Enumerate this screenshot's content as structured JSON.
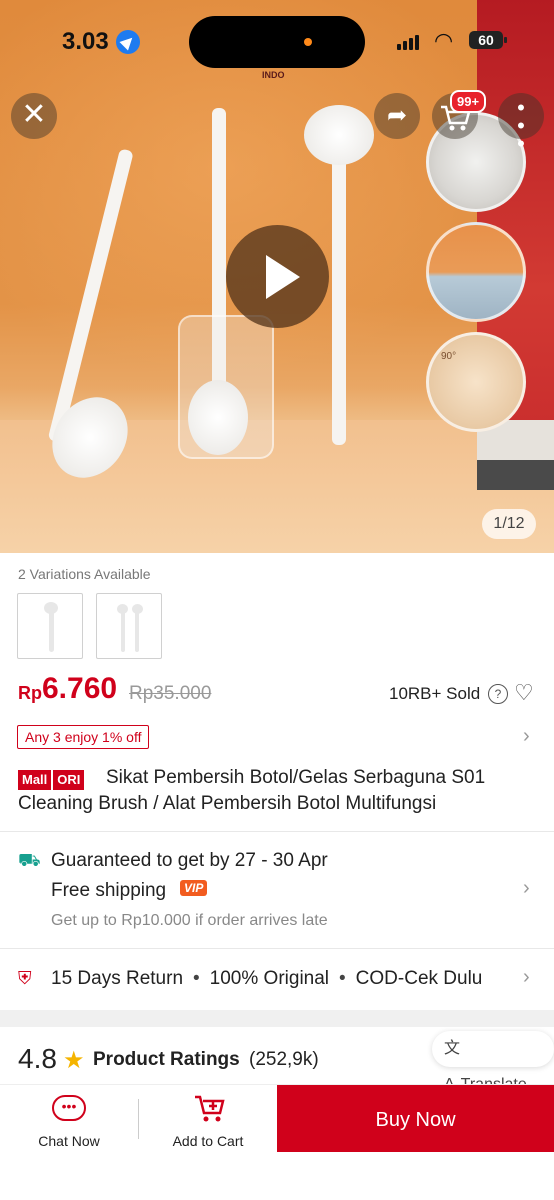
{
  "status_bar": {
    "time": "3.03",
    "battery": "60"
  },
  "media": {
    "counter": "1/12",
    "cart_badge": "99+",
    "logo": "INDO",
    "thumb3_label": "90°"
  },
  "variations": {
    "label": "2 Variations Available"
  },
  "price": {
    "currency": "Rp",
    "value": "6.760",
    "original": "Rp35.000",
    "sold": "10RB+ Sold"
  },
  "promo": {
    "label": "Any 3 enjoy 1% off"
  },
  "product": {
    "badge_mall": "Mall",
    "badge_ori": "ORI",
    "title": "Sikat Pembersih Botol/Gelas Serbaguna S01 Cleaning Brush / Alat Pembersih Botol Multifungsi"
  },
  "shipping": {
    "guarantee": "Guaranteed to get by 27 - 30 Apr",
    "free": "Free shipping",
    "vip": "VIP",
    "late": "Get up to Rp10.000 if order arrives late"
  },
  "guarantees": {
    "return": "15 Days Return",
    "original": "100% Original",
    "cod": "COD-Cek Dulu"
  },
  "ratings": {
    "value": "4.8",
    "label": "Product Ratings",
    "count": "(252,9k)",
    "translate": "Translate"
  },
  "bottom": {
    "chat": "Chat Now",
    "cart": "Add to Cart",
    "buy": "Buy Now"
  },
  "colors": {
    "accent": "#d0011b",
    "teal": "#17a08f",
    "star": "#f5b400"
  }
}
